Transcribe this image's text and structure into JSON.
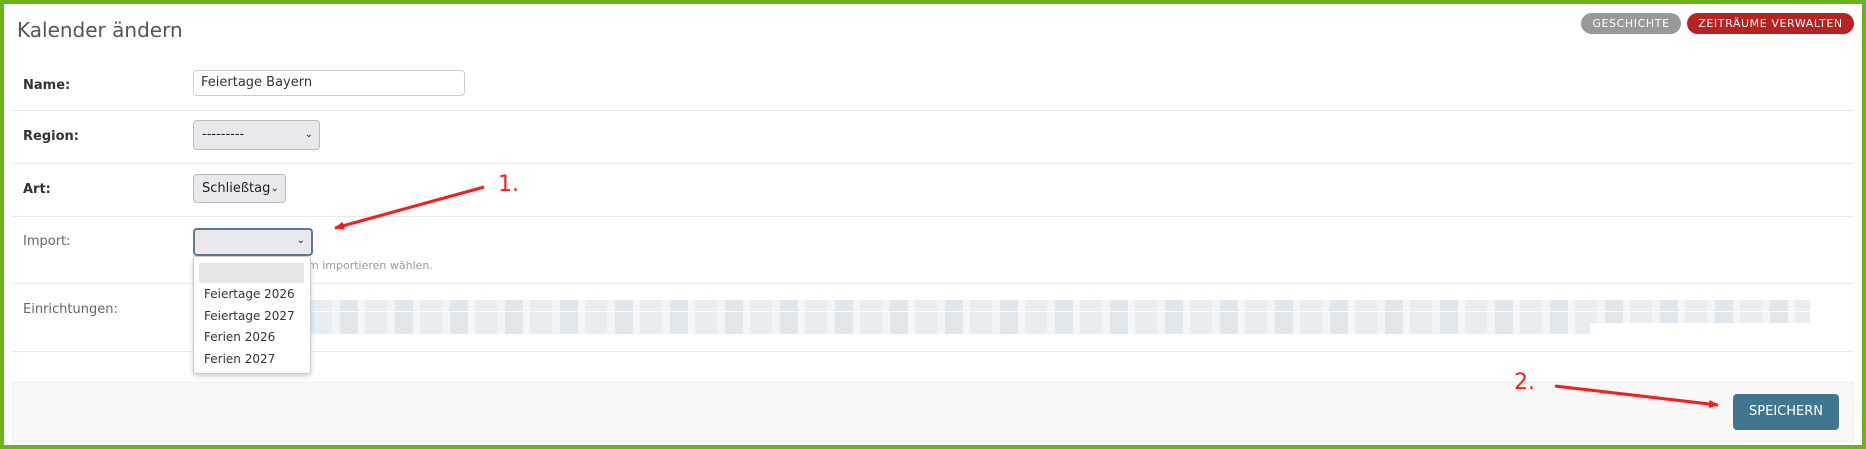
{
  "page": {
    "title": "Kalender ändern",
    "accent_color": "#6bb31a"
  },
  "toolbar": {
    "history_label": "Geschichte",
    "manage_ranges_label": "Zeiträume verwalten"
  },
  "form": {
    "name": {
      "label": "Name:",
      "value": "Feiertage Bayern"
    },
    "region": {
      "label": "Region:",
      "selected": "---------"
    },
    "art": {
      "label": "Art:",
      "selected": "Schließtag"
    },
    "import": {
      "label": "Import:",
      "selected": "",
      "help_text": "m importieren wählen.",
      "options": [
        "",
        "Feiertage 2026",
        "Feiertage 2027",
        "Ferien 2026",
        "Ferien 2027"
      ]
    },
    "einrichtungen": {
      "label": "Einrichtungen:"
    }
  },
  "footer": {
    "save_label": "Speichern"
  },
  "annotations": {
    "step1": "1.",
    "step2": "2.",
    "color": "#ff1a1a"
  }
}
